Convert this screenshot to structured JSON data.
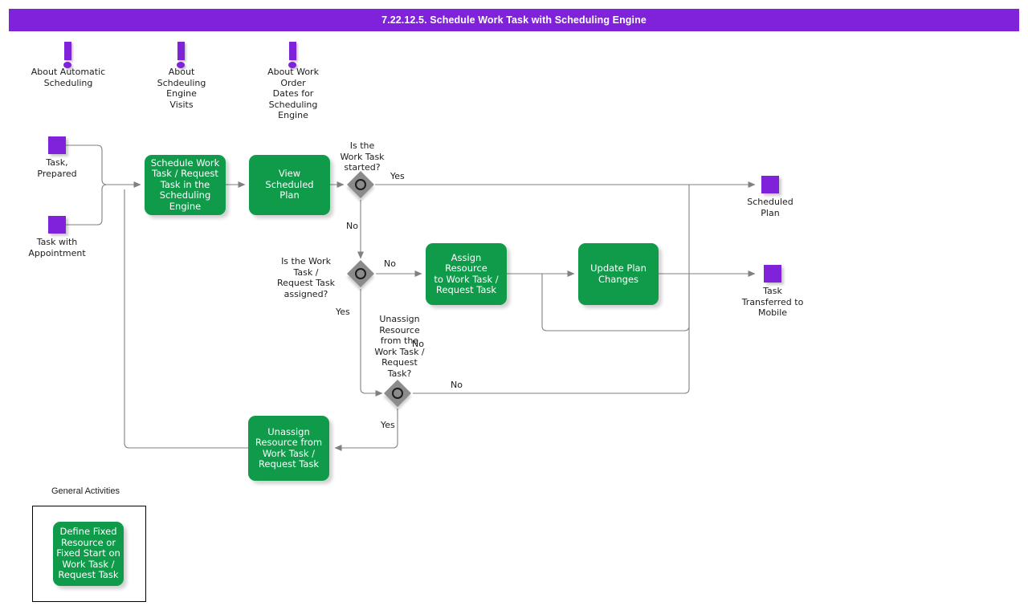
{
  "window": {
    "title": "7.22.12.5. Schedule Work Task with Scheduling Engine",
    "title_bar_color": "#8022d9"
  },
  "colors": {
    "accent_purple": "#8022d9",
    "activity_green": "#0f9b4a",
    "decision_gray": "#8b8b8b",
    "connector_gray": "#808080",
    "text_dark": "#1c1c1c"
  },
  "notes": [
    {
      "id": "note-automatic-scheduling",
      "icon": "exclamation-note-icon",
      "label": "About Automatic\nScheduling"
    },
    {
      "id": "note-scheduling-engine-visits",
      "icon": "exclamation-note-icon",
      "label": "About\nSchdeuling\nEngine\nVisits"
    },
    {
      "id": "note-work-order-dates",
      "icon": "exclamation-note-icon",
      "label": "About Work\nOrder\nDates for\nScheduling\nEngine"
    }
  ],
  "objects": [
    {
      "id": "object-task-prepared",
      "icon": "purple-square-object-icon",
      "label": "Task,\nPrepared"
    },
    {
      "id": "object-task-with-appointment",
      "icon": "purple-square-object-icon",
      "label": "Task with\nAppointment"
    },
    {
      "id": "object-scheduled-plan",
      "icon": "purple-square-object-icon",
      "label": "Scheduled\nPlan"
    },
    {
      "id": "object-task-transferred-to-mobile",
      "icon": "purple-square-object-icon",
      "label": "Task\nTransferred to\nMobile"
    }
  ],
  "activities": [
    {
      "id": "activity-schedule-work-task",
      "label": "Schedule Work\nTask / Request\nTask in the\nScheduling\nEngine"
    },
    {
      "id": "activity-view-scheduled-plan",
      "label": "View\nScheduled\nPlan"
    },
    {
      "id": "activity-assign-resource",
      "label": "Assign Resource\nto Work Task /\nRequest Task"
    },
    {
      "id": "activity-update-plan-changes",
      "label": "Update Plan\nChanges"
    },
    {
      "id": "activity-unassign-resource",
      "label": "Unassign\nResource from\nWork Task /\nRequest Task"
    },
    {
      "id": "activity-define-fixed-resource",
      "label": "Define Fixed\nResource or\nFixed Start on\nWork Task  /\nRequest Task"
    }
  ],
  "decisions": [
    {
      "id": "decision-work-task-started",
      "question": "Is the\nWork Task\nstarted?",
      "yes_label": "Yes",
      "no_label": "No"
    },
    {
      "id": "decision-work-task-assigned",
      "question": "Is the Work\nTask /\nRequest Task\nassigned?",
      "yes_label": "Yes",
      "no_label": "No"
    },
    {
      "id": "decision-unassign-resource",
      "question": "Unassign\nResource\nfrom the\nWork Task /\nRequest\nTask?",
      "yes_label": "Yes",
      "no_label": "No"
    }
  ],
  "flow_labels": {
    "d1_yes": "Yes",
    "d1_no": "No",
    "d2_no": "No",
    "d2_yes": "Yes",
    "d3_no_upper": "No",
    "d3_no_right": "No",
    "d3_yes": "Yes"
  },
  "group": {
    "title": "General Activities"
  }
}
